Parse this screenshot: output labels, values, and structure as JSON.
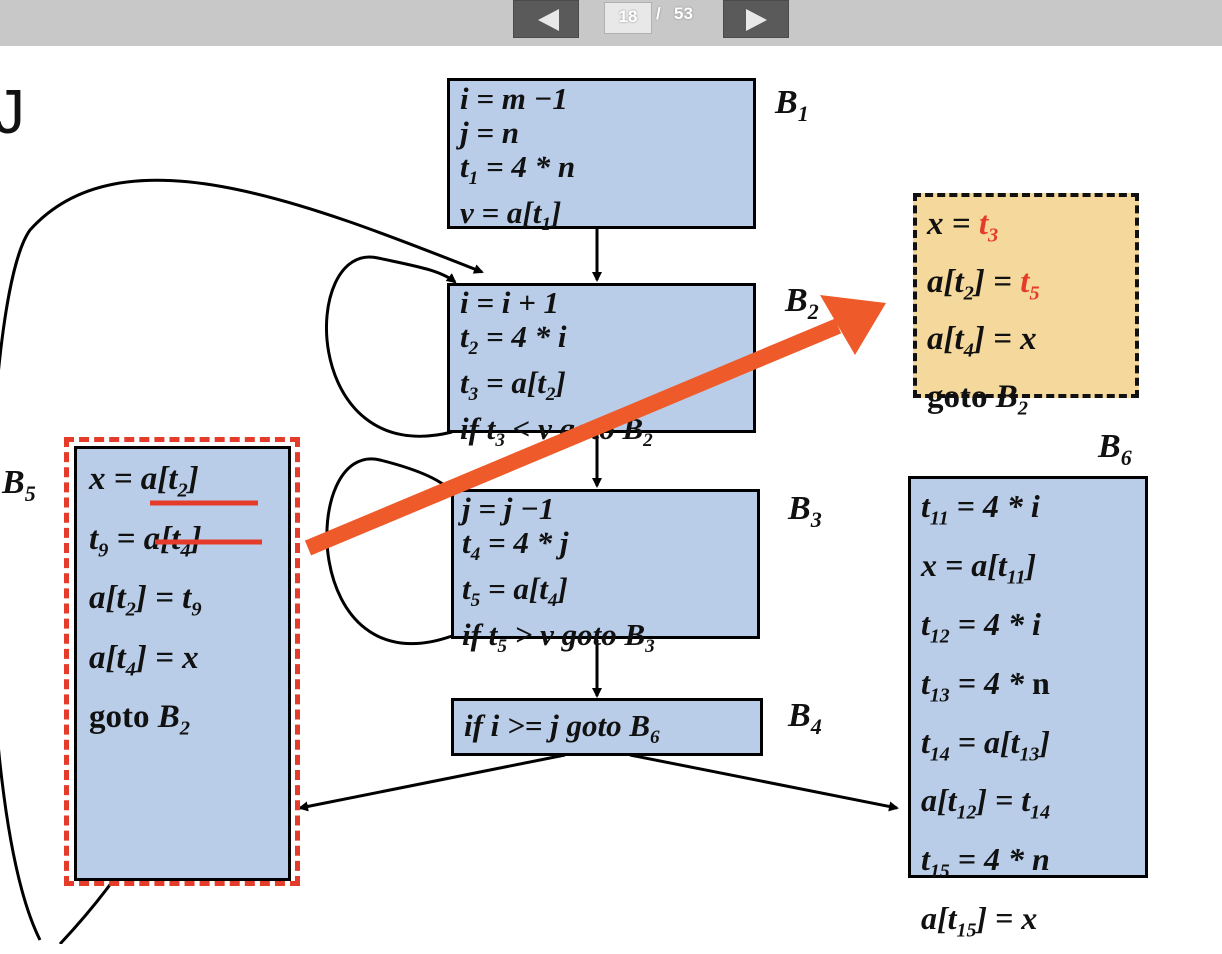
{
  "viewer": {
    "current_page": "18",
    "separator": "/",
    "total_pages": "53"
  },
  "slide": {
    "heading_fragment": "J",
    "blocks": {
      "B1": {
        "label": "B",
        "sub": "1",
        "lines": [
          "i = m −1",
          "j = n",
          "t1 = 4 * n",
          "v = a[t1]"
        ]
      },
      "B2": {
        "label": "B",
        "sub": "2",
        "lines": [
          "i = i + 1",
          "t2 = 4 * i",
          "t3 = a[t2]",
          "if t3 < v goto B2"
        ]
      },
      "B3": {
        "label": "B",
        "sub": "3",
        "lines": [
          "j = j −1",
          "t4 = 4 * j",
          "t5 = a[t4]",
          "if t5 > v goto B3"
        ]
      },
      "B4": {
        "label": "B",
        "sub": "4",
        "lines": [
          "if i >= j goto B6"
        ]
      },
      "B5": {
        "label": "B",
        "sub": "5",
        "lines": [
          "x = a[t2]",
          "t9 = a[t4]",
          "a[t2] = t9",
          "a[t4] = x",
          "goto B2"
        ]
      },
      "B6": {
        "label": "B",
        "sub": "6",
        "lines": [
          "t11 = 4 * i",
          "x = a[t11]",
          "t12 = 4 * i",
          "t13 = 4 * n",
          "t14 = a[t13]",
          "a[t12] = t14",
          "t15 = 4 * n",
          "a[t15] = x"
        ]
      },
      "optimized": {
        "lines": [
          "x = t3",
          "a[t2] = t5",
          "a[t4] = x",
          "goto B2"
        ]
      }
    }
  },
  "colors": {
    "block_fill": "#b9cde8",
    "optimized_fill": "#f5d89b",
    "highlight_red": "#e53b2b",
    "arrow_orange": "#ef5a2a",
    "toolbar": "#c8c8c8"
  }
}
